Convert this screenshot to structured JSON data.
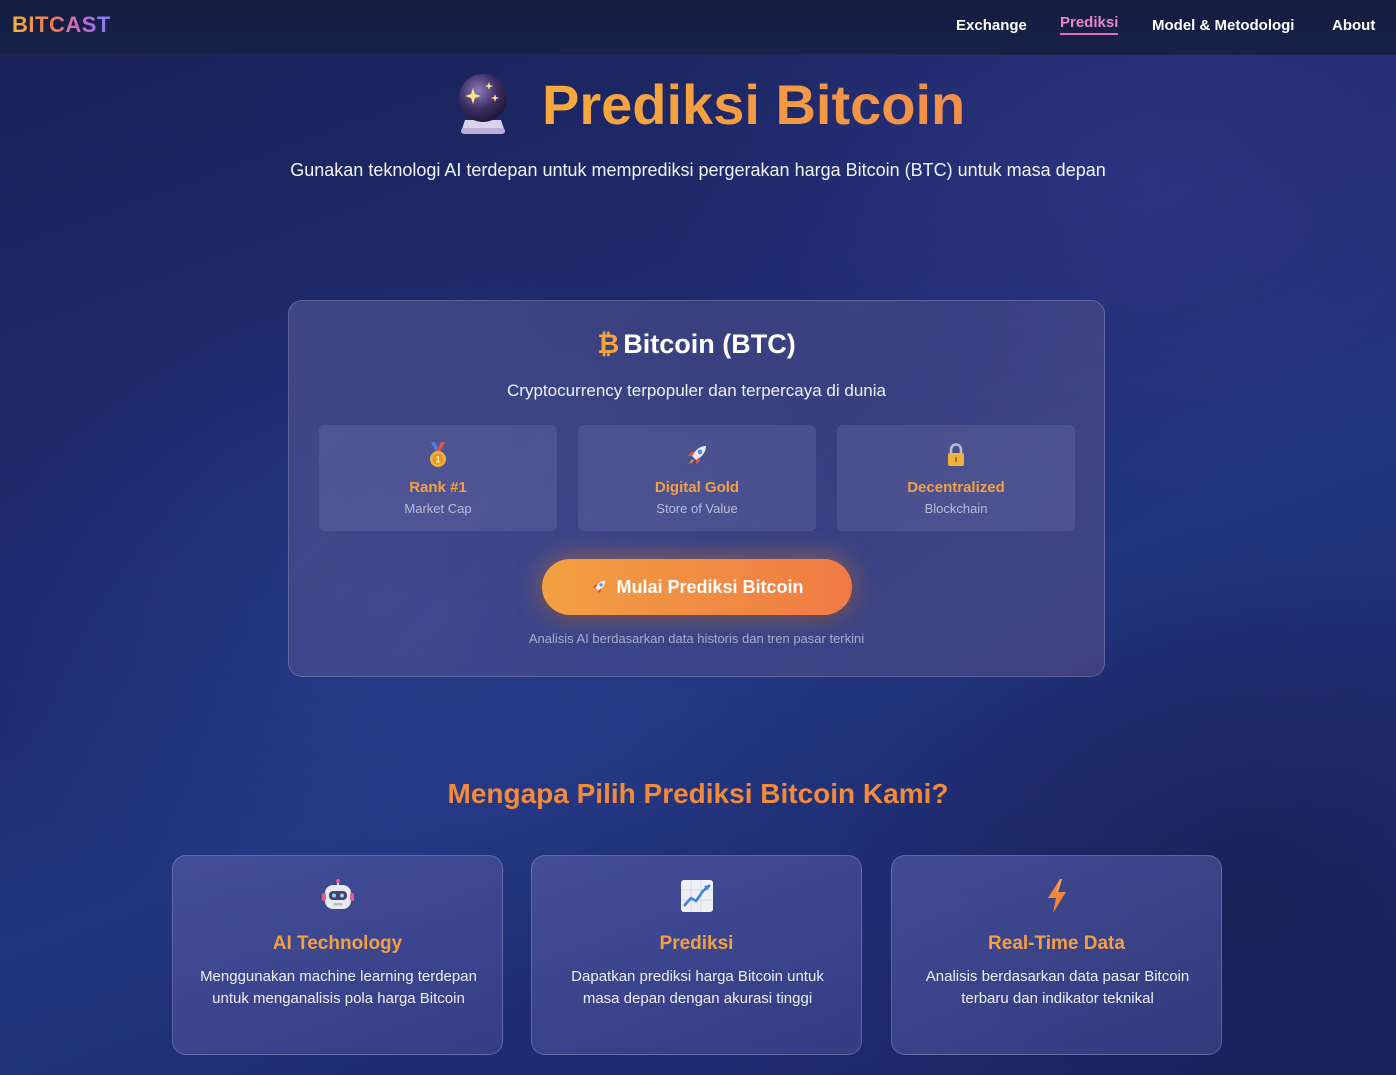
{
  "navbar": {
    "logo": "BITCAST",
    "links": [
      {
        "label": "Exchange"
      },
      {
        "label": "Prediksi",
        "active": true
      },
      {
        "label": "Model & Metodologi"
      },
      {
        "label": "About"
      }
    ]
  },
  "hero": {
    "icon": "crystal-ball-icon",
    "title": "Prediksi Bitcoin",
    "subtitle": "Gunakan teknologi AI terdepan untuk memprediksi pergerakan harga Bitcoin (BTC) untuk masa depan"
  },
  "btc_card": {
    "symbol": "₿",
    "title": "Bitcoin (BTC)",
    "description": "Cryptocurrency terpopuler dan terpercaya di dunia",
    "stats": [
      {
        "icon": "medal-icon",
        "label": "Rank #1",
        "sub": "Market Cap"
      },
      {
        "icon": "rocket-icon",
        "label": "Digital Gold",
        "sub": "Store of Value"
      },
      {
        "icon": "lock-icon",
        "label": "Decentralized",
        "sub": "Blockchain"
      }
    ],
    "cta_label": "Mulai Prediksi Bitcoin",
    "cta_icon": "rocket-icon",
    "note": "Analisis AI berdasarkan data historis dan tren pasar terkini"
  },
  "why": {
    "title": "Mengapa Pilih Prediksi Bitcoin Kami?",
    "features": [
      {
        "icon": "robot-icon",
        "title": "AI Technology",
        "description": "Menggunakan machine learning terdepan untuk menganalisis pola harga Bitcoin"
      },
      {
        "icon": "chart-increasing-icon",
        "title": "Prediksi",
        "description": "Dapatkan prediksi harga Bitcoin untuk masa depan dengan akurasi tinggi"
      },
      {
        "icon": "lightning-icon",
        "title": "Real-Time Data",
        "description": "Analisis berdasarkan data pasar Bitcoin terbaru dan indikator teknikal"
      }
    ]
  },
  "colors": {
    "accent_orange": "#f4a340",
    "nav_active": "#e988c6",
    "background": "#1f2d73"
  }
}
